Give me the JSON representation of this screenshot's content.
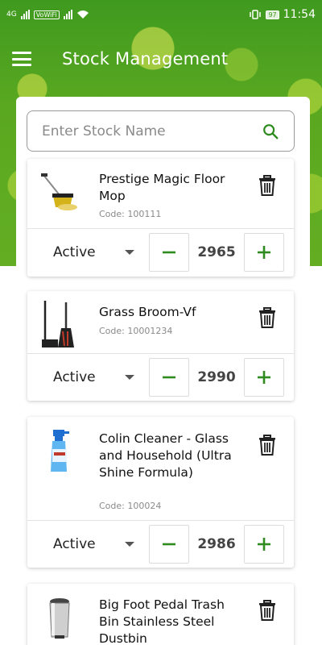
{
  "status_bar": {
    "network": "4G",
    "wifi_label": "VoWiFi",
    "battery": "97",
    "time": "11:54"
  },
  "app_bar": {
    "title": "Stock Management",
    "menu_icon": "hamburger-menu-icon"
  },
  "search": {
    "placeholder": "Enter Stock Name",
    "value": "",
    "icon": "search-icon"
  },
  "colors": {
    "brand_green": "#3f9a1f",
    "accent_green": "#2e8b1e",
    "text": "#111111",
    "muted": "#8a8a8a"
  },
  "products": [
    {
      "name": "Prestige Magic Floor Mop",
      "code": "Code: 100111",
      "status": "Active",
      "quantity": "2965",
      "image": "mop-bucket-image"
    },
    {
      "name": "Grass Broom-Vf",
      "code": "Code: 10001234",
      "status": "Active",
      "quantity": "2990",
      "image": "broom-dustpan-image"
    },
    {
      "name": "Colin Cleaner - Glass and Household (Ultra Shine Formula)",
      "code": "Code: 100024",
      "status": "Active",
      "quantity": "2986",
      "image": "spray-bottle-image"
    },
    {
      "name": "Big Foot Pedal Trash Bin Stainless Steel Dustbin",
      "code": "",
      "status": "",
      "quantity": "",
      "image": "pedal-bin-image"
    }
  ]
}
